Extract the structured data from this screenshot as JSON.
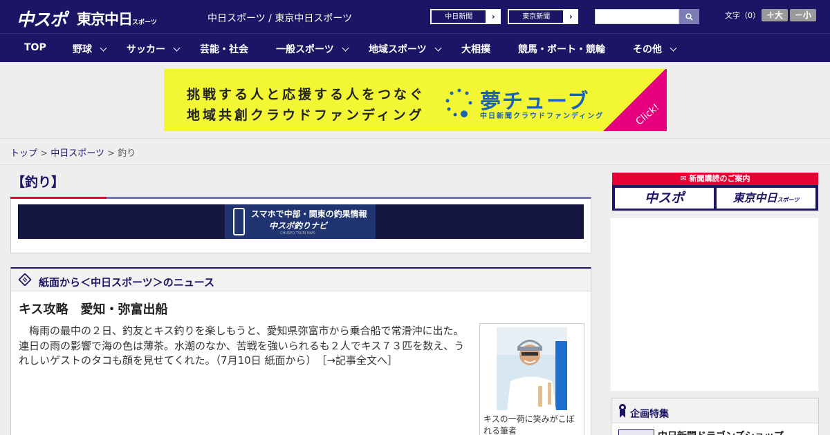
{
  "header": {
    "logo_chuspo": "中スポ",
    "logo_tokyo": "東京中日",
    "logo_tokyo_small": "スポーツ",
    "site_name": "中日スポーツ / 東京中日スポーツ",
    "paper_links": [
      "中日新聞",
      "東京新聞"
    ],
    "search_placeholder": "",
    "text_size_label": "文字（0）",
    "text_size_up": "＋大",
    "text_size_down": "－小"
  },
  "nav": {
    "items": [
      {
        "label": "TOP",
        "has_menu": false
      },
      {
        "label": "野球",
        "has_menu": true
      },
      {
        "label": "サッカー",
        "has_menu": true
      },
      {
        "label": "芸能・社会",
        "has_menu": false
      },
      {
        "label": "一般スポーツ",
        "has_menu": true
      },
      {
        "label": "地域スポーツ",
        "has_menu": true
      },
      {
        "label": "大相撲",
        "has_menu": false
      },
      {
        "label": "競馬・ボート・競輪",
        "has_menu": false
      },
      {
        "label": "その他",
        "has_menu": true
      }
    ]
  },
  "banner": {
    "line1": "挑戦する人と応援する人をつなぐ",
    "line2": "地域共創クラウドファンディング",
    "brand": "夢チューブ",
    "brand_sub": "中日新聞クラウドファンディング",
    "click": "Click!",
    "accent_color": "#f3f733"
  },
  "breadcrumb": {
    "items": [
      "トップ",
      "中日スポーツ"
    ],
    "separator": ">",
    "current": "釣り"
  },
  "category": {
    "title": "【釣り】",
    "navi_banner": {
      "line1": "スマホで中部・関東の釣果情報",
      "line2": "中スポ釣りナビ",
      "line3": "CHUSPO TSURI NAVI"
    }
  },
  "news": {
    "section_title": "紙面から＜中日スポーツ＞のニュース",
    "article_title": "キス攻略　愛知・弥富出船",
    "article_body": "　梅雨の最中の２日、釣友とキス釣りを楽しもうと、愛知県弥富市から乗合船で常滑沖に出た。連日の雨の影響で海の色は薄茶。水潮のなか、苦戦を強いられるも２人でキス７３匹を数え、うれしいゲストのタコも顔を見せてくれた。（7月10日 紙面から）　［→記事全文へ］",
    "photo_caption": "キスの一荷に笑みがこぼれる筆者"
  },
  "sidebar": {
    "subscribe_title": "新聞購読のご案内",
    "subscribe_buttons": [
      "中スポ",
      "東京中日"
    ],
    "subscribe_small": "スポーツ",
    "feature_title": "企画特集",
    "feature_item": "中日新聞ドラゴンズショップ"
  },
  "colors": {
    "brand_navy": "#1c1464",
    "accent_red": "#e60033",
    "accent_purple": "#7672b8"
  }
}
